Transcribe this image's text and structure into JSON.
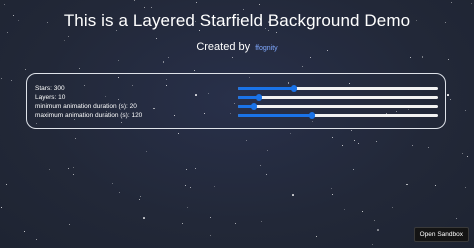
{
  "header": {
    "title": "This is a Layered Starfield Background Demo",
    "credit_prefix": "Created by",
    "credit_link": "ffognity"
  },
  "controls": [
    {
      "label": "Stars: 300",
      "value": 0.28
    },
    {
      "label": "Layers: 10",
      "value": 0.105
    },
    {
      "label": "minimum animation duration (s): 20",
      "value": 0.08
    },
    {
      "label": "maximum animation duration (s): 120",
      "value": 0.37
    }
  ],
  "footer": {
    "open_sandbox_label": "Open Sandbox"
  },
  "colors": {
    "background": "#232a3a",
    "accent": "#1a73e8",
    "link": "#7fa8ff"
  }
}
